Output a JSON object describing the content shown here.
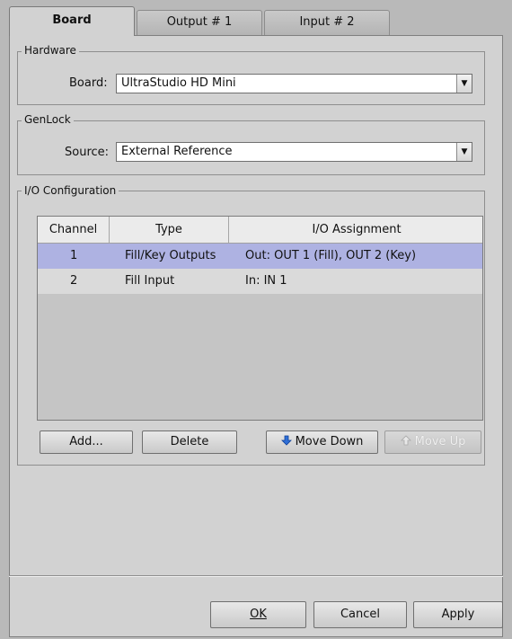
{
  "tabs": [
    {
      "label": "Board",
      "active": true
    },
    {
      "label": "Output # 1",
      "active": false
    },
    {
      "label": "Input # 2",
      "active": false
    }
  ],
  "hardware": {
    "title": "Hardware",
    "board_label": "Board:",
    "board_value": "UltraStudio HD Mini"
  },
  "genlock": {
    "title": "GenLock",
    "source_label": "Source:",
    "source_value": "External Reference"
  },
  "io_config": {
    "title": "I/O Configuration",
    "columns": [
      "Channel",
      "Type",
      "I/O Assignment"
    ],
    "rows": [
      {
        "channel": "1",
        "type": "Fill/Key Outputs",
        "assignment": "Out: OUT 1 (Fill), OUT 2 (Key)",
        "selected": true
      },
      {
        "channel": "2",
        "type": "Fill Input",
        "assignment": "In: IN 1",
        "selected": false
      }
    ],
    "buttons": {
      "add": "Add...",
      "delete": "Delete",
      "move_down": "Move Down",
      "move_up": "Move Up"
    }
  },
  "footer": {
    "ok": "OK",
    "cancel": "Cancel",
    "apply": "Apply"
  },
  "icons": {
    "move_down": "arrow-down-icon",
    "move_up": "arrow-up-icon",
    "combo_arrow": "chevron-down-icon"
  },
  "colors": {
    "selected_row": "#aeb2e2",
    "arrow_blue": "#2f6fd6"
  }
}
